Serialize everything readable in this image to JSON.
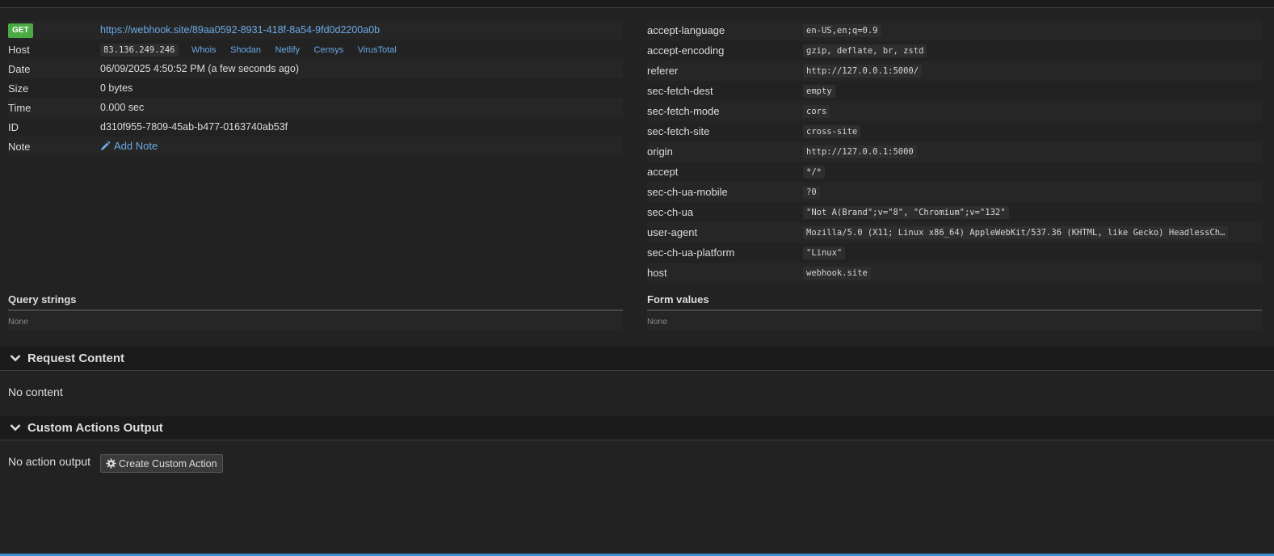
{
  "request": {
    "method": "GET",
    "url": "https://webhook.site/89aa0592-8931-418f-8a54-9fd0d2200a0b",
    "host_label": "Host",
    "host_ip": "83.136.249.246",
    "host_links": [
      "Whois",
      "Shodan",
      "Netlify",
      "Censys",
      "VirusTotal"
    ],
    "date_label": "Date",
    "date_value": "06/09/2025 4:50:52 PM (a few seconds ago)",
    "size_label": "Size",
    "size_value": "0 bytes",
    "time_label": "Time",
    "time_value": "0.000 sec",
    "id_label": "ID",
    "id_value": "d310f955-7809-45ab-b477-0163740ab53f",
    "note_label": "Note",
    "note_action": "Add Note"
  },
  "headers": [
    {
      "key": "accept-language",
      "value": "en-US,en;q=0.9"
    },
    {
      "key": "accept-encoding",
      "value": "gzip, deflate, br, zstd"
    },
    {
      "key": "referer",
      "value": "http://127.0.0.1:5000/"
    },
    {
      "key": "sec-fetch-dest",
      "value": "empty"
    },
    {
      "key": "sec-fetch-mode",
      "value": "cors"
    },
    {
      "key": "sec-fetch-site",
      "value": "cross-site"
    },
    {
      "key": "origin",
      "value": "http://127.0.0.1:5000"
    },
    {
      "key": "accept",
      "value": "*/*"
    },
    {
      "key": "sec-ch-ua-mobile",
      "value": "?0"
    },
    {
      "key": "sec-ch-ua",
      "value": "\"Not A(Brand\";v=\"8\", \"Chromium\";v=\"132\""
    },
    {
      "key": "user-agent",
      "value": "Mozilla/5.0 (X11; Linux x86_64) AppleWebKit/537.36 (KHTML, like Gecko) HeadlessCh…"
    },
    {
      "key": "sec-ch-ua-platform",
      "value": "\"Linux\""
    },
    {
      "key": "host",
      "value": "webhook.site"
    }
  ],
  "query_strings": {
    "title": "Query strings",
    "value": "None"
  },
  "form_values": {
    "title": "Form values",
    "value": "None"
  },
  "request_content": {
    "title": "Request Content",
    "value": "No content"
  },
  "custom_actions": {
    "title": "Custom Actions Output",
    "value": "No action output",
    "button": "Create Custom Action"
  },
  "icons": {
    "chevron": "chevron-down-icon",
    "pencil": "pencil-icon",
    "gear": "gear-icon"
  },
  "colors": {
    "link": "#6aa9e6",
    "badge": "#4aaa44",
    "background": "#222222"
  }
}
